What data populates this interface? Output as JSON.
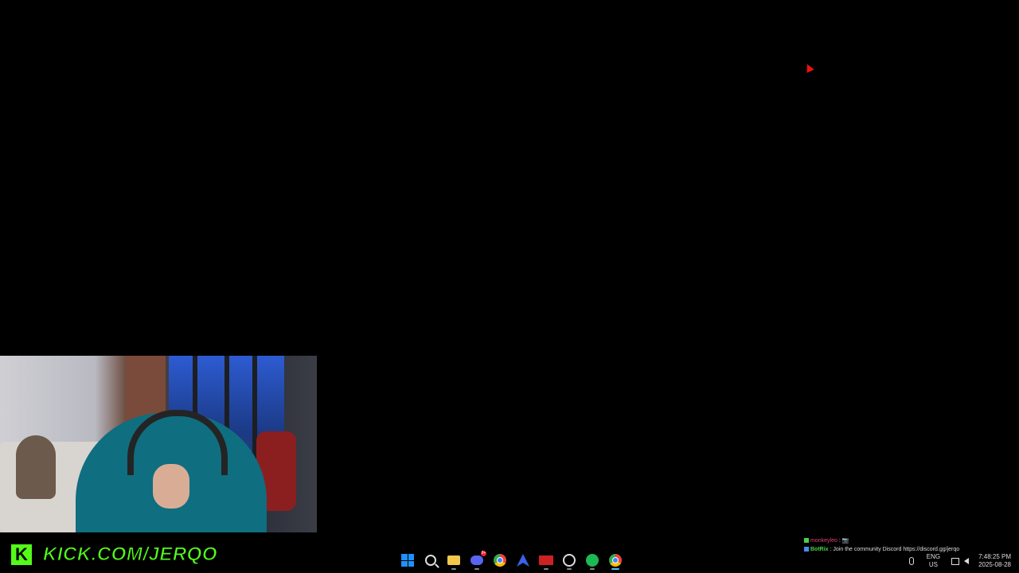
{
  "overlay": {
    "kick_logo": "K",
    "kick_url": "KICK.COM/JERQO"
  },
  "chat": {
    "messages": [
      {
        "user": "monkeyleo",
        "sep": ":",
        "text": "📷"
      },
      {
        "user": "BotRix",
        "sep": ":",
        "text": "Join the community Discord https://discord.gg/jerqo"
      }
    ]
  },
  "taskbar": {
    "apps": [
      {
        "name": "start",
        "icon": "windows-icon"
      },
      {
        "name": "search",
        "icon": "search-icon"
      },
      {
        "name": "file-explorer",
        "icon": "folder-icon"
      },
      {
        "name": "discord",
        "icon": "discord-icon",
        "badge": "9+"
      },
      {
        "name": "chrome",
        "icon": "chrome-icon"
      },
      {
        "name": "vpn",
        "icon": "vpn-icon"
      },
      {
        "name": "obs",
        "icon": "obs-icon"
      },
      {
        "name": "steam",
        "icon": "steam-icon"
      },
      {
        "name": "spotify",
        "icon": "spotify-icon"
      },
      {
        "name": "chrome-active",
        "icon": "chrome-icon"
      }
    ],
    "tray": {
      "lang_top": "ENG",
      "lang_bottom": "US",
      "time": "7:48:25 PM",
      "date": "2025-08-28"
    }
  },
  "colors": {
    "kick_green": "#53fc18",
    "background": "#000000",
    "taskbar_accent": "#4cc2ff"
  }
}
